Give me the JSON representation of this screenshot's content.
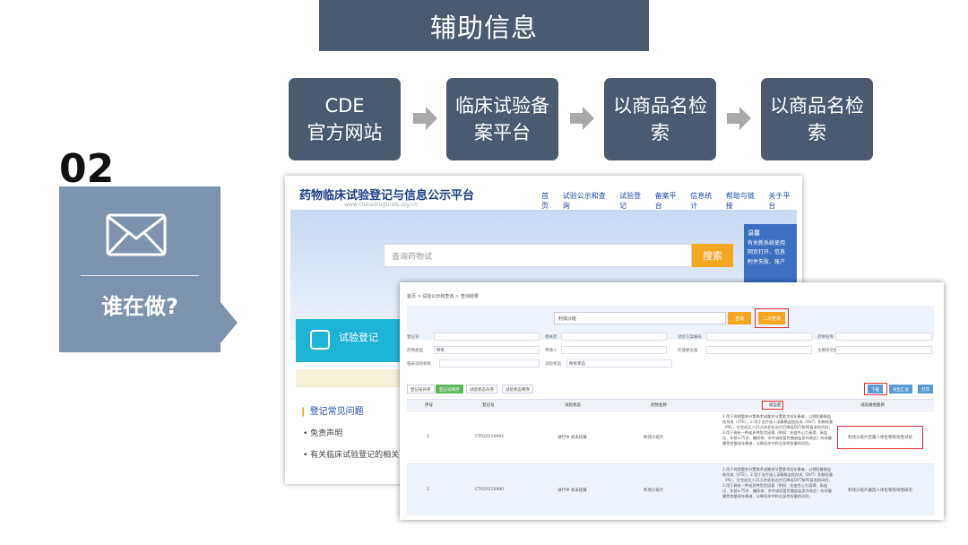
{
  "header": {
    "title": "辅助信息"
  },
  "steps": [
    {
      "line1": "CDE",
      "line2": "官方网站"
    },
    {
      "line1": "临床试验备",
      "line2": "案平台"
    },
    {
      "line1": "以商品名检",
      "line2": "索"
    },
    {
      "line1": "以商品名检",
      "line2": "索"
    }
  ],
  "left_panel": {
    "number": "02",
    "label": "谁在做?",
    "icon": "envelope-icon"
  },
  "screenshot1": {
    "site_title": "药物临床试验登记与信息公示平台",
    "site_url": "www.chinadrugtrials.org.cn",
    "nav": [
      "首页",
      "试验公示和查询",
      "试验登记",
      "备案平台",
      "信息统计",
      "帮助与链接",
      "关于平台"
    ],
    "search_placeholder": "查询药物试",
    "search_button": "搜索",
    "side_box_title": "温馨",
    "side_box_lines": [
      "有关新系统使用",
      "网页打开、信息",
      "附件失败、账户"
    ],
    "banner_text": "试验登记",
    "faq_title": "登记常见问题",
    "faq_items": [
      "免责声明",
      "有关临床试验登记的相关要求"
    ]
  },
  "screenshot2": {
    "breadcrumb": "首页 > 试验公示和查询 > 查询结果",
    "search_value": "利伐沙班",
    "query_button": "查询",
    "second_query_button": "二次查询",
    "form_rows": [
      [
        {
          "label": "登记号",
          "value": ""
        },
        {
          "label": "相关药",
          "value": ""
        },
        {
          "label": "试验方案编号",
          "value": ""
        },
        {
          "label": "药物名称",
          "value": ""
        }
      ],
      [
        {
          "label": "药物类型",
          "value": "所有"
        },
        {
          "label": "申请人",
          "value": ""
        },
        {
          "label": "伦理委员会",
          "value": ""
        },
        {
          "label": "主要研究者",
          "value": ""
        }
      ],
      [
        {
          "label": "临床试验机构",
          "value": ""
        },
        {
          "label": "试验状态",
          "value": "所有状态"
        }
      ]
    ],
    "toolbar": [
      "登记号升序",
      "登记号降序",
      "试验状态升序",
      "试验状态降序"
    ],
    "toolbar_right": [
      "下载",
      "导出汇总",
      "打印"
    ],
    "table_headers": [
      "序号",
      "登记号",
      "试验状态",
      "药物名称",
      "适应症",
      "试验通俗题目"
    ],
    "rows": [
      {
        "index": "1",
        "reg_no": "CTR20210993",
        "status": "进行中 尚未招募",
        "drug": "利伐沙班片",
        "indication": "1.用于择期髋关节置换术或膝关节置换术成年患者，以预防静脉血栓形成（VTE）；2.用于治疗成人深静脉血栓形成（DVT）和肺栓塞（PE），在完成至少21天的初始治疗后降低DVT和PE复发的风险；3.用于具有一种或多种危险因素（例如：充血性心力衰竭、高血压、年龄≥75岁、糖尿病、卒中或短暂性脑缺血发作病史）的非瓣膜性房颤成年患者，以降低卒中和全身性栓塞的风险。",
        "title": "利伐沙班片空腹人体生物等效性试验"
      },
      {
        "index": "2",
        "reg_no": "CTR20210990",
        "status": "进行中 尚未招募",
        "drug": "利伐沙班片",
        "indication": "1.用于择期髋关节置换术或膝关节置换术成年患者，以预防静脉血栓形成（VTE）；2.用于治疗成人深静脉血栓形成（DVT）和肺栓塞（PE），在完成至少21天的初始治疗后降低DVT和PE复发的风险；3.用于具有一种或多种危险因素（例如：充血性心力衰竭、高血压、年龄≥75岁、糖尿病、卒中或短暂性脑缺血发作病史）的非瓣膜性房颤成年患者，以降低卒中和全身性栓塞的风险。",
        "title": "利伐沙班片餐后人体生物等效性研究"
      }
    ]
  },
  "colors": {
    "slate": "#4b5a6f",
    "panel": "#7e93ad",
    "arrow": "#a9a9a9",
    "highlight": "#e03131",
    "orange": "#f5a623"
  }
}
